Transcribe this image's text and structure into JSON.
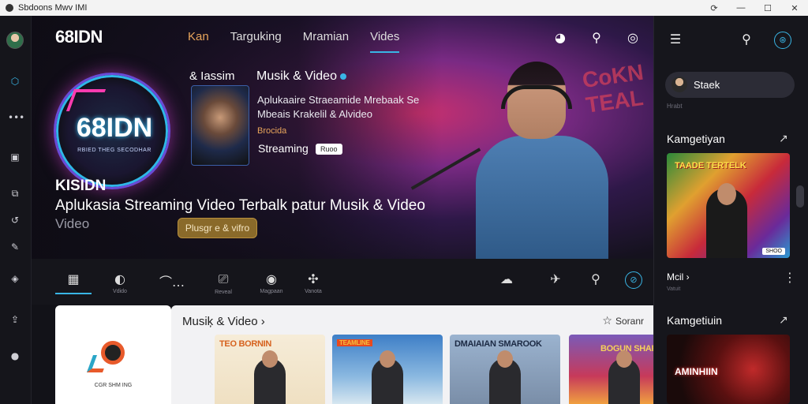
{
  "window": {
    "title": "Sbdoons Mwv IMI",
    "controls": [
      "⟳",
      "—",
      "☐",
      "✕"
    ]
  },
  "leftbar": {
    "icons": [
      "hex-icon",
      "more-icon",
      "grid-icon",
      "image-icon",
      "history-icon",
      "edit-icon",
      "game-icon",
      "upload-icon",
      "help-icon"
    ]
  },
  "header": {
    "logo": "68IDN",
    "logo_accent": "N",
    "nav": [
      "Kan",
      "Targuking",
      "Mramian",
      "Vides"
    ],
    "active_nav": "Vides"
  },
  "hero": {
    "disc_text": "68IDN",
    "disc_sub": "RBIED THEG SECODHAR",
    "title": "KISIDN",
    "subtitle": "Aplukasia Streaming Video Terbalk patur Musik & Video",
    "video_label": "Video",
    "play_label": "Plusgr e & vifro",
    "feature": {
      "label": "& Iassim",
      "title": "Musik & Video",
      "desc": "Aplukaaire Straeamide Mrebaak Se Mbeais Krakelil & Alvideo",
      "meta": "Brocida",
      "stream": "Streaming",
      "tag": "Ruoo"
    },
    "graffiti": "CoKN TEAL"
  },
  "tabs": [
    {
      "icon": "▦",
      "label": ""
    },
    {
      "icon": "◐",
      "label": "Vdido"
    },
    {
      "icon": "⌒…",
      "label": ""
    },
    {
      "icon": "⎚",
      "label": "Reveal"
    },
    {
      "icon": "◉",
      "label": "Magpaan"
    },
    {
      "icon": "✣",
      "label": "Vanota"
    }
  ],
  "tab_actions": [
    "☁",
    "✈",
    "⚲",
    "⊘"
  ],
  "promo": {
    "text": "CGR SHM ING"
  },
  "list": {
    "title": "Musiķ & Video ›",
    "sort_label": "Soranr",
    "cards": [
      {
        "title": "TEO BORNIN"
      },
      {
        "title": "TEAMLINE"
      },
      {
        "title": "DMAIAIAN SMAROOK"
      },
      {
        "title": "BOGUN SHAROO"
      }
    ]
  },
  "rightbar": {
    "search_text": "Staek",
    "small_text": "Hrabt",
    "section1": "Kamgetiyan",
    "img1_title": "TAADE TERTELK",
    "img1_tag": "SHOO",
    "more": "Mcil ›",
    "more_sub": "Vatuit",
    "section2": "Kamgetiuin",
    "img2_title": "AMINHIIN"
  },
  "colors": {
    "accent": "#39b5e5",
    "brand_green": "#2fe07a",
    "orange": "#e8a55b"
  }
}
